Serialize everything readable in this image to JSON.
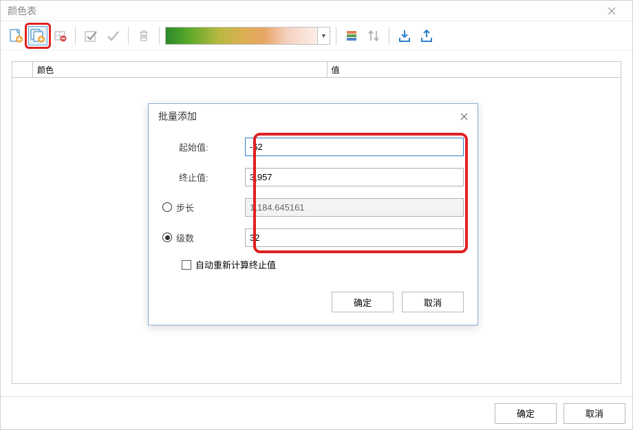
{
  "window": {
    "title": "颜色表"
  },
  "table": {
    "col_color": "颜色",
    "col_value": "值"
  },
  "buttons": {
    "ok": "确定",
    "cancel": "取消"
  },
  "dialog": {
    "title": "批量添加",
    "labels": {
      "start": "起始值:",
      "end": "终止值:",
      "step": "步长",
      "levels": "级数"
    },
    "values": {
      "start": "-62",
      "end": "3,957",
      "step": "1,184.645161",
      "levels": "32"
    },
    "checkbox_label": "自动重新计算终止值",
    "ok": "确定",
    "cancel": "取消"
  }
}
